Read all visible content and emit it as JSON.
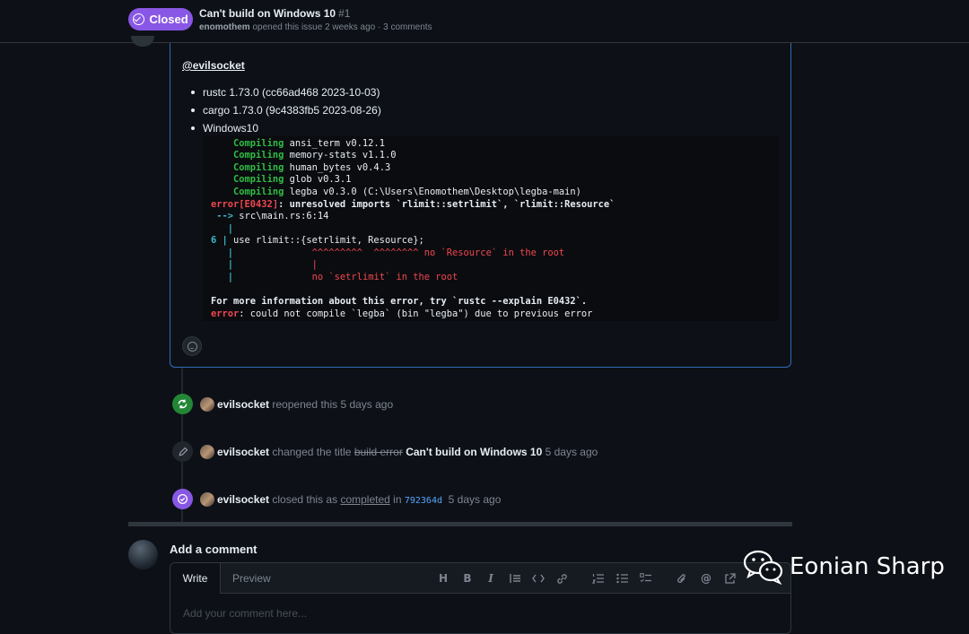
{
  "header": {
    "state": "Closed",
    "title": "Can't build on Windows 10",
    "number": "#1",
    "author": "enomothem",
    "meta_text": "opened this issue 2 weeks ago · 3 comments"
  },
  "comment": {
    "mention": "@evilsocket",
    "env": [
      "rustc 1.73.0 (cc66ad468 2023-10-03)",
      "cargo 1.73.0 (9c4383fb5 2023-08-26)",
      "Windows10"
    ],
    "terminal": {
      "l1_kw": "Compiling",
      "l1_rest": " ansi_term v0.12.1",
      "l2_kw": "Compiling",
      "l2_rest": " memory-stats v1.1.0",
      "l3_kw": "Compiling",
      "l3_rest": " human_bytes v0.4.3",
      "l4_kw": "Compiling",
      "l4_rest": " glob v0.3.1",
      "l5_kw": "Compiling",
      "l5_rest": " legba v0.3.0 (C:\\Users\\Enomothem\\Desktop\\legba-main)",
      "l6_err": "error[E0432]",
      "l6_rest": ": unresolved imports `rlimit::setrlimit`, `rlimit::Resource`",
      "l7_arrow": "-->",
      "l7_rest": " src\\main.rs:6:14",
      "l8_pipe": "|",
      "l9_num": "6 |",
      "l9_rest": " use rlimit::{setrlimit, Resource};",
      "l10_pipe": "|",
      "l10_red": "^^^^^^^^^  ^^^^^^^^ no `Resource` in the root",
      "l11_pipe": "|",
      "l11_red": "|",
      "l12_pipe": "|",
      "l12_red": "no `setrlimit` in the root",
      "l13": "For more information about this error, try `rustc --explain E0432`.",
      "l14_err": "error",
      "l14_rest": ": could not compile `legba` (bin \"legba\") due to previous error"
    }
  },
  "timeline": [
    {
      "user": "evilsocket",
      "text": "reopened this 5 days ago"
    },
    {
      "user": "evilsocket",
      "pre": "changed the title",
      "old_title": "build error",
      "new_title": "Can't build on Windows 10",
      "time": "5 days ago"
    },
    {
      "user": "evilsocket",
      "pre": "closed this as",
      "reason": "completed",
      "mid": "in",
      "commit": "792364d",
      "time": "5 days ago"
    }
  ],
  "composer": {
    "title": "Add a comment",
    "tab_write": "Write",
    "tab_preview": "Preview",
    "placeholder": "Add your comment here..."
  },
  "watermark": "Eonian Sharp",
  "colors": {
    "closed": "#8957e5",
    "reopened": "#238636",
    "accent": "#2f6bb5"
  }
}
